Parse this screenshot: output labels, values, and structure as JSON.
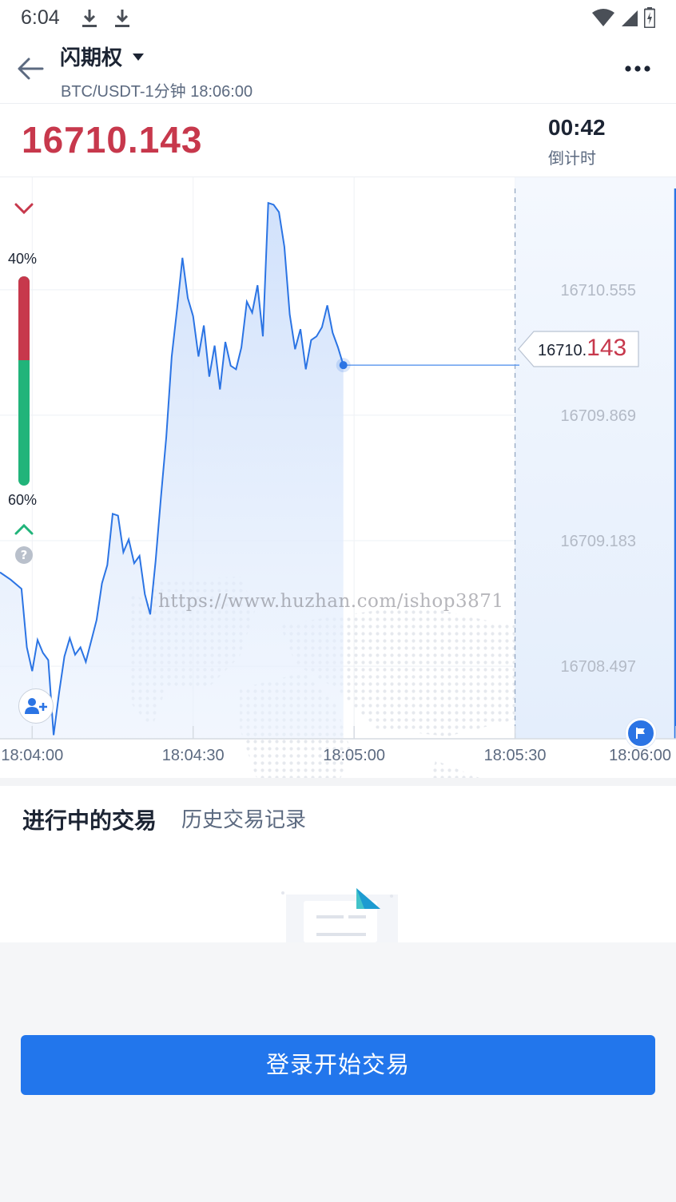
{
  "status_bar": {
    "time": "6:04",
    "icons": [
      "download-icon",
      "download-icon",
      "wifi-icon",
      "signal-icon",
      "battery-icon"
    ]
  },
  "header": {
    "title": "闪期权",
    "subtitle": "BTC/USDT-1分钟 18:06:00",
    "icons": [
      "back-arrow-icon",
      "caret-down-icon",
      "more-dots-icon"
    ]
  },
  "price": {
    "current": "16710.143",
    "countdown": "00:42",
    "countdown_label": "倒计时"
  },
  "ratio": {
    "down_label": "40%",
    "up_label": "60%",
    "down_fraction": 0.4,
    "down_color": "#c7384c",
    "up_color": "#21b47a",
    "help_glyph": "?"
  },
  "chart_data": {
    "type": "line",
    "title": "",
    "xlabel": "",
    "ylabel": "",
    "x_ticks": [
      "18:04:00",
      "18:04:30",
      "18:05:00",
      "18:05:30",
      "18:06:00"
    ],
    "y_ticks": [
      "16710.555",
      "16709.869",
      "16709.183",
      "16708.497"
    ],
    "y_tick_values": [
      16710.555,
      16709.869,
      16709.183,
      16708.497
    ],
    "x_unit": "seconds after 18:04:00",
    "xlim": [
      -6,
      120
    ],
    "ylim": [
      16708.1,
      16711.17
    ],
    "series": [
      {
        "color": "#2b74e4",
        "points": [
          [
            -6,
            16709.01
          ],
          [
            -4,
            16708.97
          ],
          [
            -2,
            16708.92
          ],
          [
            -1,
            16708.6
          ],
          [
            0,
            16708.47
          ],
          [
            1,
            16708.64
          ],
          [
            2,
            16708.57
          ],
          [
            3,
            16708.53
          ],
          [
            4,
            16708.12
          ],
          [
            5,
            16708.35
          ],
          [
            6,
            16708.55
          ],
          [
            7,
            16708.65
          ],
          [
            8,
            16708.56
          ],
          [
            9,
            16708.6
          ],
          [
            10,
            16708.52
          ],
          [
            12,
            16708.75
          ],
          [
            13,
            16708.95
          ],
          [
            14,
            16709.05
          ],
          [
            15,
            16709.33
          ],
          [
            16,
            16709.32
          ],
          [
            17,
            16709.12
          ],
          [
            18,
            16709.19
          ],
          [
            19,
            16709.06
          ],
          [
            20,
            16709.1
          ],
          [
            21,
            16708.89
          ],
          [
            22,
            16708.78
          ],
          [
            23,
            16709.07
          ],
          [
            24,
            16709.42
          ],
          [
            25,
            16709.75
          ],
          [
            26,
            16710.19
          ],
          [
            27,
            16710.45
          ],
          [
            28,
            16710.73
          ],
          [
            29,
            16710.51
          ],
          [
            30,
            16710.41
          ],
          [
            31,
            16710.19
          ],
          [
            32,
            16710.36
          ],
          [
            33,
            16710.08
          ],
          [
            34,
            16710.25
          ],
          [
            35,
            16710.01
          ],
          [
            36,
            16710.27
          ],
          [
            37,
            16710.14
          ],
          [
            38,
            16710.12
          ],
          [
            39,
            16710.24
          ],
          [
            40,
            16710.49
          ],
          [
            41,
            16710.43
          ],
          [
            42,
            16710.58
          ],
          [
            43,
            16710.3
          ],
          [
            44,
            16711.03
          ],
          [
            45,
            16711.02
          ],
          [
            46,
            16710.98
          ],
          [
            47,
            16710.79
          ],
          [
            48,
            16710.42
          ],
          [
            49,
            16710.23
          ],
          [
            50,
            16710.34
          ],
          [
            51,
            16710.12
          ],
          [
            52,
            16710.28
          ],
          [
            53,
            16710.3
          ],
          [
            54,
            16710.35
          ],
          [
            55,
            16710.47
          ],
          [
            56,
            16710.32
          ],
          [
            57,
            16710.24
          ],
          [
            58,
            16710.143
          ]
        ]
      }
    ],
    "current_price_int": "16710.",
    "current_price_dec": "143",
    "grid": true,
    "shaded_region_start": 90
  },
  "trades": {
    "tab_active": "进行中的交易",
    "tab_history": "历史交易记录"
  },
  "login_button": "登录开始交易",
  "watermark": "https://www.huzhan.com/ishop3871",
  "colors": {
    "accent": "#2276ec",
    "price_red": "#c7384c",
    "line_blue": "#2b74e4"
  }
}
